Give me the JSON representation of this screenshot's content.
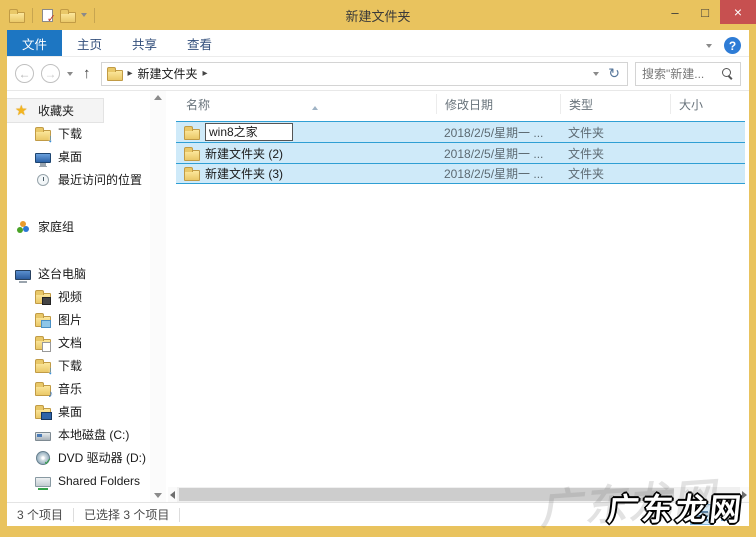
{
  "window": {
    "title": "新建文件夹",
    "controls": {
      "minimize": "–",
      "maximize": "□",
      "close": "×"
    }
  },
  "quick_access": {
    "icons": [
      "explorer-icon",
      "properties-icon",
      "new-folder-icon",
      "qat-dropdown-icon"
    ]
  },
  "ribbon": {
    "tabs": [
      {
        "label": "文件",
        "selected": true
      },
      {
        "label": "主页",
        "selected": false
      },
      {
        "label": "共享",
        "selected": false
      },
      {
        "label": "查看",
        "selected": false
      }
    ]
  },
  "address_bar": {
    "back_icon": "←",
    "forward_icon": "→",
    "up_icon": "↑",
    "separator": "▸",
    "location": "新建文件夹",
    "refresh_icon": "↻"
  },
  "search": {
    "placeholder": "搜索\"新建..."
  },
  "help": {
    "glyph": "?"
  },
  "sidebar": {
    "items": [
      {
        "label": "收藏夹",
        "icon": "star-icon",
        "level": 0,
        "highlight": true
      },
      {
        "label": "下载",
        "icon": "folder-download-icon",
        "level": 1
      },
      {
        "label": "桌面",
        "icon": "desktop-icon",
        "level": 1
      },
      {
        "label": "最近访问的位置",
        "icon": "recent-icon",
        "level": 1
      },
      {
        "label": "家庭组",
        "icon": "homegroup-icon",
        "level": 0,
        "gap_before": true
      },
      {
        "label": "这台电脑",
        "icon": "computer-icon",
        "level": 0,
        "gap_before": true
      },
      {
        "label": "视频",
        "icon": "folder-video-icon",
        "level": 1
      },
      {
        "label": "图片",
        "icon": "folder-picture-icon",
        "level": 1
      },
      {
        "label": "文档",
        "icon": "folder-doc-icon",
        "level": 1
      },
      {
        "label": "下载",
        "icon": "folder-download-icon",
        "level": 1
      },
      {
        "label": "音乐",
        "icon": "folder-music-icon",
        "level": 1
      },
      {
        "label": "桌面",
        "icon": "folder-desktop-icon",
        "level": 1
      },
      {
        "label": "本地磁盘 (C:)",
        "icon": "disk-icon",
        "level": 1
      },
      {
        "label": "DVD 驱动器 (D:)",
        "icon": "dvd-icon",
        "level": 1
      },
      {
        "label": "Shared Folders",
        "icon": "network-folder-icon",
        "level": 1
      }
    ]
  },
  "file_list": {
    "columns": [
      {
        "label": "名称"
      },
      {
        "label": "修改日期"
      },
      {
        "label": "类型"
      },
      {
        "label": "大小"
      }
    ],
    "rows": [
      {
        "name": "win8之家",
        "date": "2018/2/5/星期一 ...",
        "type": "文件夹",
        "size": "",
        "renaming": true,
        "selected": true
      },
      {
        "name": "新建文件夹 (2)",
        "date": "2018/2/5/星期一 ...",
        "type": "文件夹",
        "size": "",
        "renaming": false,
        "selected": true
      },
      {
        "name": "新建文件夹 (3)",
        "date": "2018/2/5/星期一 ...",
        "type": "文件夹",
        "size": "",
        "renaming": false,
        "selected": true
      }
    ]
  },
  "status_bar": {
    "items_count": "3 个项目",
    "selected_count": "已选择 3 个项目"
  },
  "watermark": {
    "text": "广东龙网"
  },
  "colors": {
    "titlebar": "#e9c35e",
    "tab_selected": "#1d76c2",
    "selection_fill": "#cfeaf9",
    "selection_border": "#2f9fd4",
    "close_red": "#c75050",
    "help_blue": "#2e7cd6"
  }
}
